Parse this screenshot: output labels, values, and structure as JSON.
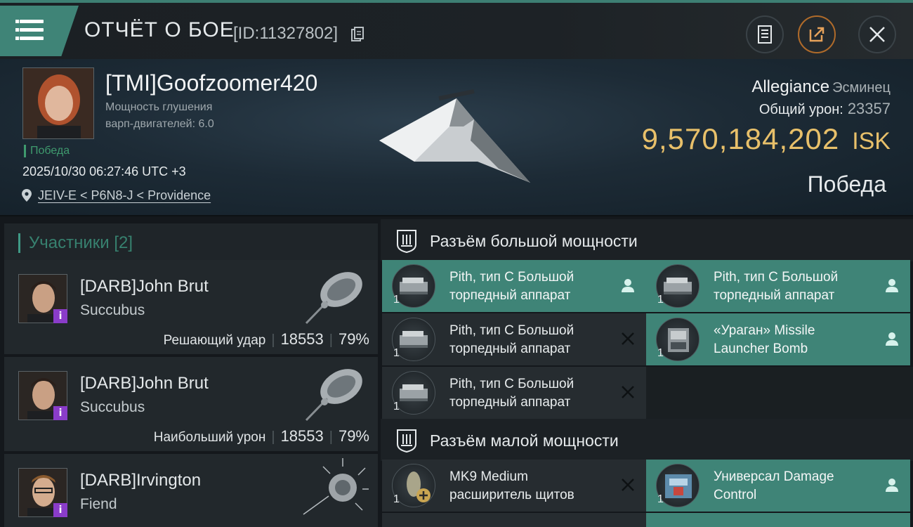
{
  "header": {
    "title": "ОТЧЁТ О БОЕ",
    "report_id": "[ID:11327802]",
    "menu_icon": "hamburger-icon",
    "actions": [
      "notes-icon",
      "share-icon",
      "close-icon"
    ]
  },
  "victim": {
    "name": "[TMI]Goofzoomer420",
    "warp_label": "Мощность глушения",
    "warp_value": "варп-двигателей: 6.0",
    "result_small": "Победа",
    "timestamp": "2025/10/30 06:27:46 UTC +3",
    "location": "JEIV-E < P6N8-J < Providence",
    "ship": "Allegiance",
    "ship_class": "Эсминец",
    "damage_label": "Общий урон:",
    "damage_value": "23357",
    "isk_amount": "9,570,184,202",
    "isk_currency": "ISK",
    "result_big": "Победа"
  },
  "participants": {
    "label": "Участники",
    "count": "[2]",
    "items": [
      {
        "name": "[DARB]John Brut",
        "ship": "Succubus",
        "role": "Решающий удар",
        "damage": "18553",
        "percent": "79%"
      },
      {
        "name": "[DARB]John Brut",
        "ship": "Succubus",
        "role": "Наибольший урон",
        "damage": "18553",
        "percent": "79%"
      },
      {
        "name": "[DARB]Irvington",
        "ship": "Fiend",
        "role": "",
        "damage": "",
        "percent": ""
      }
    ]
  },
  "fitting": {
    "high_slot_label": "Разъём большой мощности",
    "low_slot_label": "Разъём малой мощности",
    "high_modules": [
      {
        "line1": "Pith, тип C Большой",
        "line2": "торпедный аппарат",
        "qty": "1",
        "status": "person-icon",
        "selected": true
      },
      {
        "line1": "Pith, тип C Большой",
        "line2": "торпедный аппарат",
        "qty": "1",
        "status": "person-icon",
        "selected": true
      },
      {
        "line1": "Pith, тип C Большой",
        "line2": "торпедный аппарат",
        "qty": "1",
        "status": "destroyed-icon",
        "selected": false
      },
      {
        "line1": "«Ураган» Missile",
        "line2": "Launcher Bomb",
        "qty": "1",
        "status": "person-icon",
        "selected": true
      },
      {
        "line1": "Pith, тип C Большой",
        "line2": "торпедный аппарат",
        "qty": "1",
        "status": "destroyed-icon",
        "selected": false
      }
    ],
    "low_modules": [
      {
        "line1": "MK9 Medium",
        "line2": "расширитель щитов",
        "qty": "1",
        "status": "destroyed-icon",
        "selected": false
      },
      {
        "line1": "Универсал Damage",
        "line2": "Control",
        "qty": "1",
        "status": "person-icon",
        "selected": true
      }
    ]
  },
  "colors": {
    "accent_teal": "#3f8477",
    "isk_gold": "#e8c06a",
    "victory_green": "#3f9a6e",
    "info_purple": "#8a3cc9"
  }
}
